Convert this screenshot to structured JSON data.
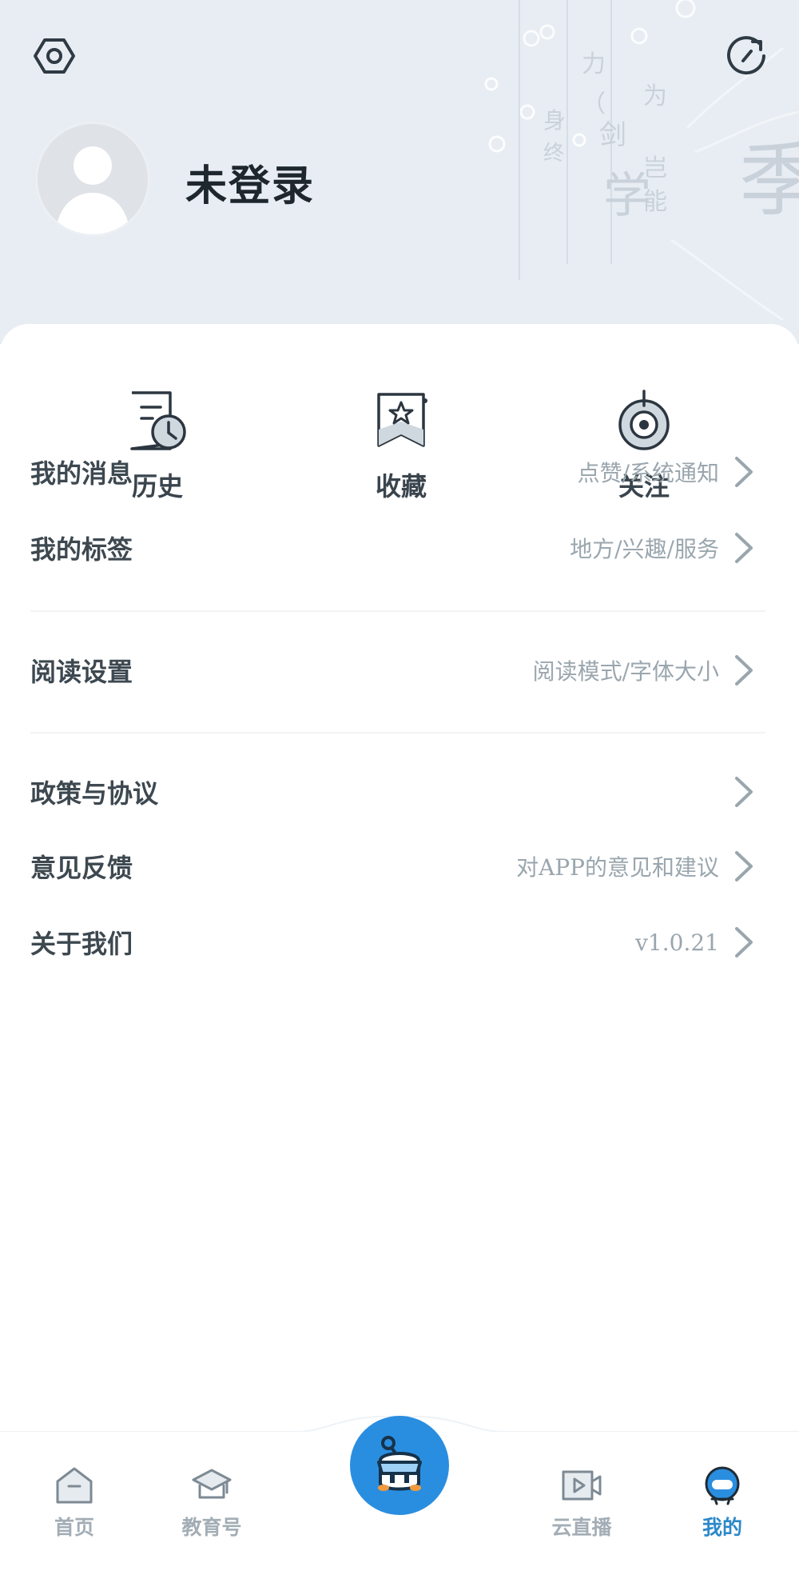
{
  "header": {
    "title": "未登录"
  },
  "quick_actions": [
    {
      "label": "历史",
      "icon": "history-clock-icon"
    },
    {
      "label": "收藏",
      "icon": "bookmark-star-icon"
    },
    {
      "label": "关注",
      "icon": "follow-target-icon"
    }
  ],
  "menu": {
    "messages": {
      "label": "我的消息",
      "sub": "点赞/系统通知"
    },
    "tags": {
      "label": "我的标签",
      "sub": "地方/兴趣/服务"
    },
    "reading": {
      "label": "阅读设置",
      "sub": "阅读模式/字体大小"
    },
    "policy": {
      "label": "政策与协议",
      "sub": ""
    },
    "feedback": {
      "label": "意见反馈",
      "sub": "对APP的意见和建议"
    },
    "about": {
      "label": "关于我们",
      "sub": "v1.0.21"
    }
  },
  "tabs": {
    "home": "首页",
    "edu": "教育号",
    "live": "云直播",
    "mine": "我的"
  },
  "colors": {
    "accent": "#2d88c9",
    "header_bg": "#e8edf3",
    "muted": "#9aa6ae"
  }
}
